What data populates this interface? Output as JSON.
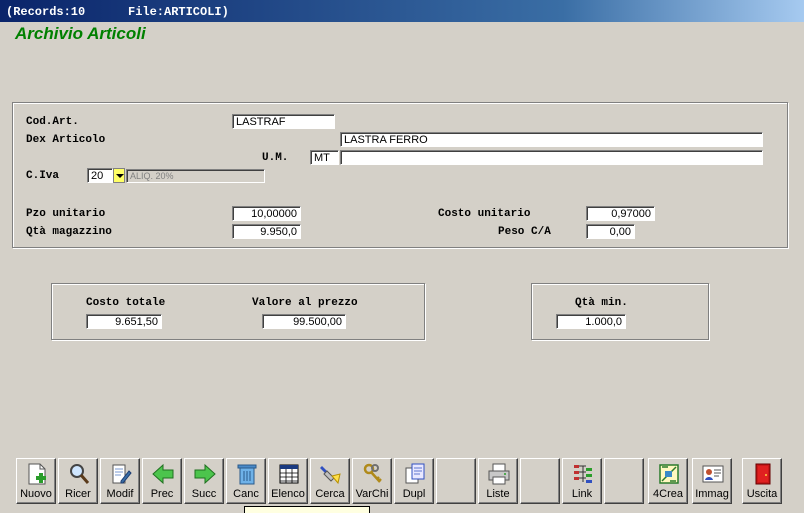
{
  "titlebar": {
    "records": "(Records:10",
    "file": "File:ARTICOLI)"
  },
  "app_title": "Archivio Articoli",
  "form": {
    "cod_art_label": "Cod.Art.",
    "cod_art_value": "LASTRAF",
    "dex_label": "Dex Articolo",
    "dex_value": "LASTRA FERRO",
    "um_label": "U.M.",
    "um_value": "MT",
    "um_desc_value": "",
    "civa_label": "C.Iva",
    "civa_value": "20",
    "civa_desc": "ALIQ. 20%",
    "pzo_label": "Pzo unitario",
    "pzo_value": "10,00000",
    "costo_unit_label": "Costo unitario",
    "costo_unit_value": "0,97000",
    "qta_label": "Qtà magazzino",
    "qta_value": "9.950,0",
    "peso_label": "Peso C/A",
    "peso_value": "0,00"
  },
  "totals": {
    "costo_totale_label": "Costo totale",
    "costo_totale_value": "9.651,50",
    "valore_label": "Valore al prezzo",
    "valore_value": "99.500,00",
    "qta_min_label": "Qtà min.",
    "qta_min_value": "1.000,0"
  },
  "toolbar": {
    "nuovo": "Nuovo",
    "ricer": "Ricer",
    "modif": "Modif",
    "prec": "Prec",
    "succ": "Succ",
    "canc": "Canc",
    "elenco": "Elenco",
    "cerca": "Cerca",
    "varchi": "VarChi",
    "dupl": "Dupl",
    "liste": "Liste",
    "link": "Link",
    "crea": "4Crea",
    "immag": "Immag",
    "uscita": "Uscita"
  },
  "icons": {
    "nuovo": "new-document-icon",
    "ricer": "magnifier-icon",
    "modif": "edit-document-icon",
    "prec": "arrow-left-icon",
    "succ": "arrow-right-icon",
    "canc": "trash-icon",
    "elenco": "table-list-icon",
    "cerca": "flashlight-icon",
    "varchi": "keys-icon",
    "dupl": "duplicate-icon",
    "liste": "printer-icon",
    "link": "link-grid-icon",
    "crea": "build-icon",
    "immag": "image-card-icon",
    "uscita": "exit-door-icon"
  },
  "colors": {
    "title_green": "#008000",
    "window_bg": "#d4d0c8",
    "titlebar": "#0a246a"
  }
}
